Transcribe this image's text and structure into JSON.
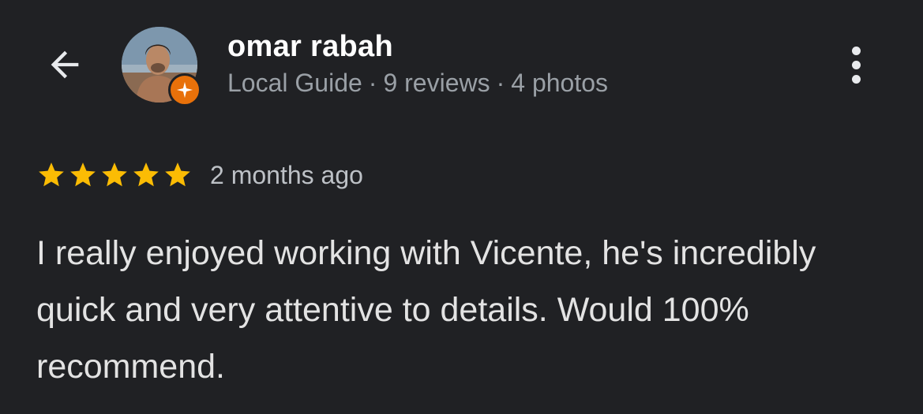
{
  "header": {
    "back_icon": "arrow-left-icon",
    "more_icon": "more-vert-icon",
    "icon_color": "#e8eaed"
  },
  "user": {
    "name": "omar rabah",
    "badge": "Local Guide",
    "separator": "·",
    "reviews": "9 reviews",
    "photos": "4 photos",
    "badge_icon": "local-guide-badge-icon",
    "badge_color": "#e8710a"
  },
  "review": {
    "rating": 5,
    "max_rating": 5,
    "star_color": "#fbbc04",
    "date": "2 months ago",
    "text": "I really enjoyed working with Vicente, he's incredibly quick and very attentive to details. Would 100% recommend."
  }
}
